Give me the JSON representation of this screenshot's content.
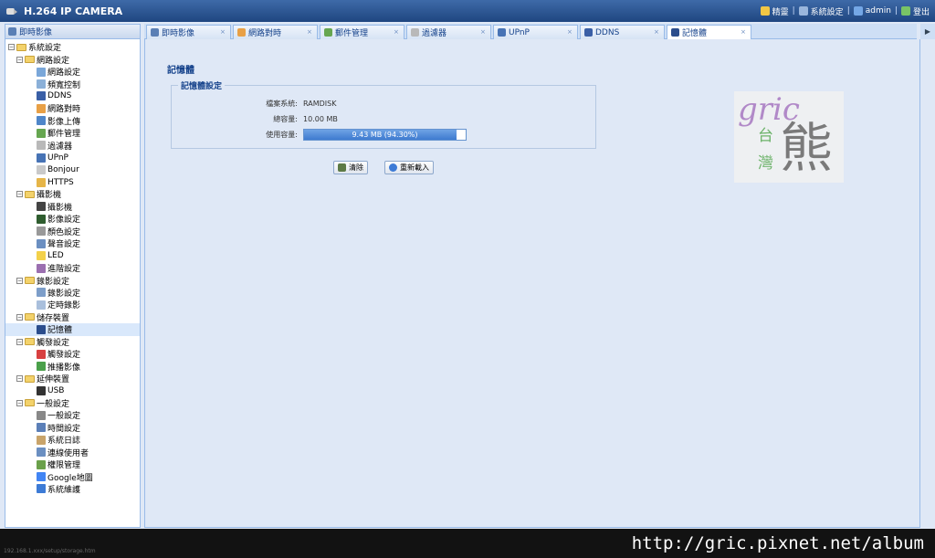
{
  "app": {
    "title": "H.264 IP CAMERA"
  },
  "topbar": {
    "links": [
      {
        "label": "精靈",
        "icon": "wizard-icon",
        "color": "#f2c744"
      },
      {
        "label": "系統設定",
        "icon": "settings-icon",
        "color": "#9ab6dc"
      },
      {
        "label": "admin",
        "icon": "user-icon",
        "color": "#74a7e6"
      },
      {
        "label": "登出",
        "icon": "logout-icon",
        "color": "#79c466"
      }
    ]
  },
  "sidebar": {
    "header": "即時影像",
    "tree": [
      {
        "label": "系統設定",
        "level": 0,
        "toggle": "−"
      },
      {
        "label": "網路設定",
        "level": 1,
        "toggle": "−"
      },
      {
        "label": "網路設定",
        "level": 2,
        "color": "#7aa7d9"
      },
      {
        "label": "頻寬控制",
        "level": 2,
        "color": "#8bb0d8"
      },
      {
        "label": "DDNS",
        "level": 2,
        "color": "#3a5fa6"
      },
      {
        "label": "網路對時",
        "level": 2,
        "color": "#e8a046"
      },
      {
        "label": "影像上傳",
        "level": 2,
        "color": "#4f86c9"
      },
      {
        "label": "郵件管理",
        "level": 2,
        "color": "#66a650"
      },
      {
        "label": "過濾器",
        "level": 2,
        "color": "#b9b9b9"
      },
      {
        "label": "UPnP",
        "level": 2,
        "color": "#4773b5"
      },
      {
        "label": "Bonjour",
        "level": 2,
        "color": "#c9c9c9"
      },
      {
        "label": "HTTPS",
        "level": 2,
        "color": "#e6b548"
      },
      {
        "label": "攝影機",
        "level": 1,
        "toggle": "−"
      },
      {
        "label": "攝影機",
        "level": 2,
        "color": "#444444"
      },
      {
        "label": "影像設定",
        "level": 2,
        "color": "#2f5d2f"
      },
      {
        "label": "顏色設定",
        "level": 2,
        "color": "#999999"
      },
      {
        "label": "聲音設定",
        "level": 2,
        "color": "#6b8fc1"
      },
      {
        "label": "LED",
        "level": 2,
        "color": "#f3d14a"
      },
      {
        "label": "進階設定",
        "level": 2,
        "color": "#9b6fb0"
      },
      {
        "label": "錄影設定",
        "level": 1,
        "toggle": "−"
      },
      {
        "label": "錄影設定",
        "level": 2,
        "color": "#7d9ec9"
      },
      {
        "label": "定時錄影",
        "level": 2,
        "color": "#a9bfdc"
      },
      {
        "label": "儲存裝置",
        "level": 1,
        "toggle": "−"
      },
      {
        "label": "記憶體",
        "level": 2,
        "color": "#2b4d8c",
        "selected": true
      },
      {
        "label": "觸發設定",
        "level": 1,
        "toggle": "−"
      },
      {
        "label": "觸發設定",
        "level": 2,
        "color": "#d84040"
      },
      {
        "label": "推播影像",
        "level": 2,
        "color": "#4aa04a"
      },
      {
        "label": "延伸裝置",
        "level": 1,
        "toggle": "−"
      },
      {
        "label": "USB",
        "level": 2,
        "color": "#333333"
      },
      {
        "label": "一般設定",
        "level": 1,
        "toggle": "−"
      },
      {
        "label": "一般設定",
        "level": 2,
        "color": "#888888"
      },
      {
        "label": "時間設定",
        "level": 2,
        "color": "#5b7fb8"
      },
      {
        "label": "系統日誌",
        "level": 2,
        "color": "#c9a46a"
      },
      {
        "label": "連線使用者",
        "level": 2,
        "color": "#6b8fc1"
      },
      {
        "label": "權限管理",
        "level": 2,
        "color": "#6aa04a"
      },
      {
        "label": "Google地圖",
        "level": 2,
        "color": "#4285f4"
      },
      {
        "label": "系統維護",
        "level": 2,
        "color": "#3d7bd6"
      }
    ]
  },
  "tabs": [
    {
      "label": "即時影像",
      "icon": "live-view-icon",
      "color": "#5a7fb5"
    },
    {
      "label": "網路對時",
      "icon": "ntp-icon",
      "color": "#e8a046"
    },
    {
      "label": "郵件管理",
      "icon": "mail-icon",
      "color": "#66a650"
    },
    {
      "label": "過濾器",
      "icon": "filter-icon",
      "color": "#b9b9b9"
    },
    {
      "label": "UPnP",
      "icon": "upnp-icon",
      "color": "#4773b5"
    },
    {
      "label": "DDNS",
      "icon": "ddns-icon",
      "color": "#3a5fa6"
    },
    {
      "label": "記憶體",
      "icon": "memory-icon",
      "color": "#2b4d8c",
      "active": true
    }
  ],
  "main": {
    "title": "記憶體",
    "legend": "記憶體設定",
    "fields": [
      {
        "label": "檔案系統:",
        "value": "RAMDISK"
      },
      {
        "label": "總容量:",
        "value": "10.00 MB"
      },
      {
        "label": "使用容量:"
      }
    ],
    "usage": {
      "percent": 94.3,
      "text": "9.43 MB (94.30%)"
    },
    "buttons": {
      "clear": "清除",
      "reload": "重新載入"
    }
  },
  "watermark": {
    "text1": "gric",
    "text2": "台",
    "text3": "灣",
    "text4": "熊",
    "url": "http://gric.pixnet.net/album"
  },
  "status": {
    "text": "192.168.1.xxx/setup/storage.htm"
  }
}
